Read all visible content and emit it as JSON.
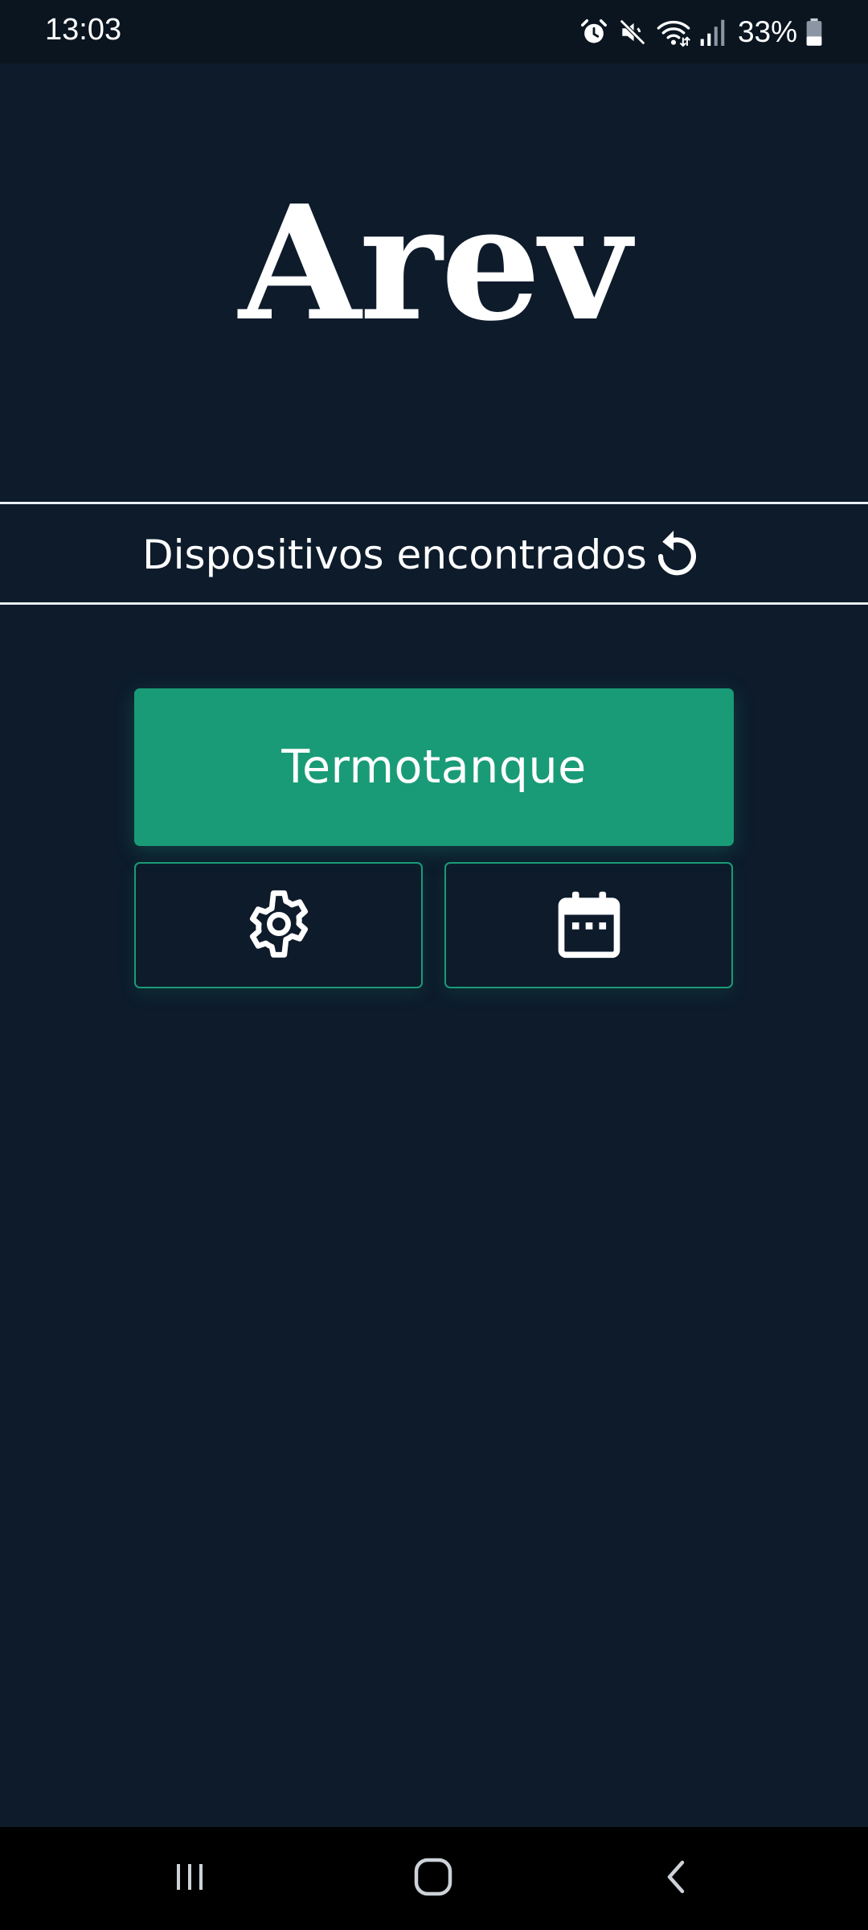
{
  "status_bar": {
    "time": "13:03",
    "battery": "33%",
    "icons": [
      "alarm-icon",
      "mute-icon",
      "wifi-icon",
      "signal-icon",
      "battery-icon"
    ]
  },
  "app": {
    "title": "Arev"
  },
  "devices": {
    "header_label": "Dispositivos encontrados",
    "refresh_icon": "refresh-icon",
    "items": [
      {
        "name": "Termotanque",
        "actions": [
          "gear-icon",
          "calendar-icon"
        ]
      }
    ]
  },
  "nav_bar": {
    "items": [
      "recents-icon",
      "home-icon",
      "back-icon"
    ]
  },
  "colors": {
    "background": "#0d1b2b",
    "accent": "#1a9b77",
    "text": "#ffffff"
  }
}
